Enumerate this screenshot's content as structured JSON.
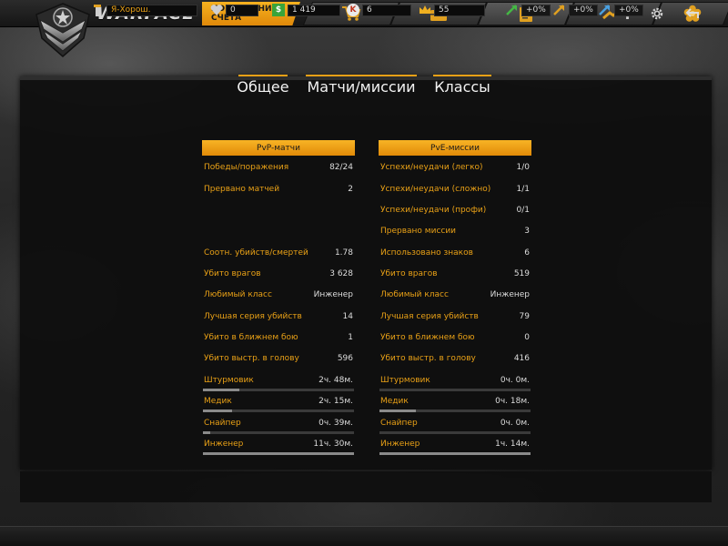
{
  "app": {
    "logo_text": "WARFACE",
    "topup_label": "ПОПОЛНЕНИЕ СЧЕТА"
  },
  "nav": {
    "tabs": [
      {
        "icon": "cart-icon"
      },
      {
        "icon": "briefcase-icon"
      },
      {
        "icon": "clipboard-icon"
      },
      {
        "icon": "trend-icon"
      },
      {
        "icon": "flower-icon"
      }
    ],
    "active_index": 2,
    "help_label": "?",
    "settings_icon": "gear-icon",
    "exit_icon": "return-arrow-icon"
  },
  "tabs": [
    {
      "label": "Общее"
    },
    {
      "label": "Матчи/миссии"
    },
    {
      "label": "Классы"
    }
  ],
  "active_tab": 1,
  "pvp": {
    "header": "PvP-матчи",
    "rows": [
      {
        "label": "Победы/поражения",
        "value": "82/24"
      },
      {
        "label": "Прервано матчей",
        "value": "2"
      },
      {
        "label": "Соотн. убийств/смертей",
        "value": "1.78"
      },
      {
        "label": "Убито врагов",
        "value": "3 628"
      },
      {
        "label": "Любимый класс",
        "value": "Инженер"
      },
      {
        "label": "Лучшая серия убийств",
        "value": "14"
      },
      {
        "label": "Убито в ближнем бою",
        "value": "1"
      },
      {
        "label": "Убито выстр. в голову",
        "value": "596"
      }
    ],
    "classes": [
      {
        "label": "Штурмовик",
        "value": "2ч. 48м.",
        "fill": 0.24
      },
      {
        "label": "Медик",
        "value": "2ч. 15м.",
        "fill": 0.19
      },
      {
        "label": "Снайпер",
        "value": "0ч. 39м.",
        "fill": 0.05
      },
      {
        "label": "Инженер",
        "value": "11ч. 30м.",
        "fill": 1.0
      }
    ]
  },
  "pve": {
    "header": "PvE-миссии",
    "rows": [
      {
        "label": "Успехи/неудачи (легко)",
        "value": "1/0"
      },
      {
        "label": "Успехи/неудачи (сложно)",
        "value": "1/1"
      },
      {
        "label": "Успехи/неудачи (профи)",
        "value": "0/1"
      },
      {
        "label": "Прервано миссии",
        "value": "3"
      },
      {
        "label": "Использовано знаков",
        "value": "6"
      },
      {
        "label": "Убито врагов",
        "value": "519"
      },
      {
        "label": "Любимый класс",
        "value": "Инженер"
      },
      {
        "label": "Лучшая серия убийств",
        "value": "79"
      },
      {
        "label": "Убито в ближнем бою",
        "value": "0"
      },
      {
        "label": "Убито выстр. в голову",
        "value": "416"
      }
    ],
    "classes": [
      {
        "label": "Штурмовик",
        "value": "0ч. 0м.",
        "fill": 0.0
      },
      {
        "label": "Медик",
        "value": "0ч. 18м.",
        "fill": 0.24
      },
      {
        "label": "Снайпер",
        "value": "0ч. 0м.",
        "fill": 0.0
      },
      {
        "label": "Инженер",
        "value": "1ч. 14м.",
        "fill": 1.0
      }
    ]
  },
  "status": {
    "player_name": "Я-Хорош.",
    "reward_count": "0",
    "money": "1 419",
    "kredits": "6",
    "crowns": "55",
    "boost_xp": "+0%",
    "boost_vp": "+0%",
    "boost_money": "+0%"
  },
  "colors": {
    "accent": "#e8a016",
    "money_green": "#3aa43a"
  }
}
